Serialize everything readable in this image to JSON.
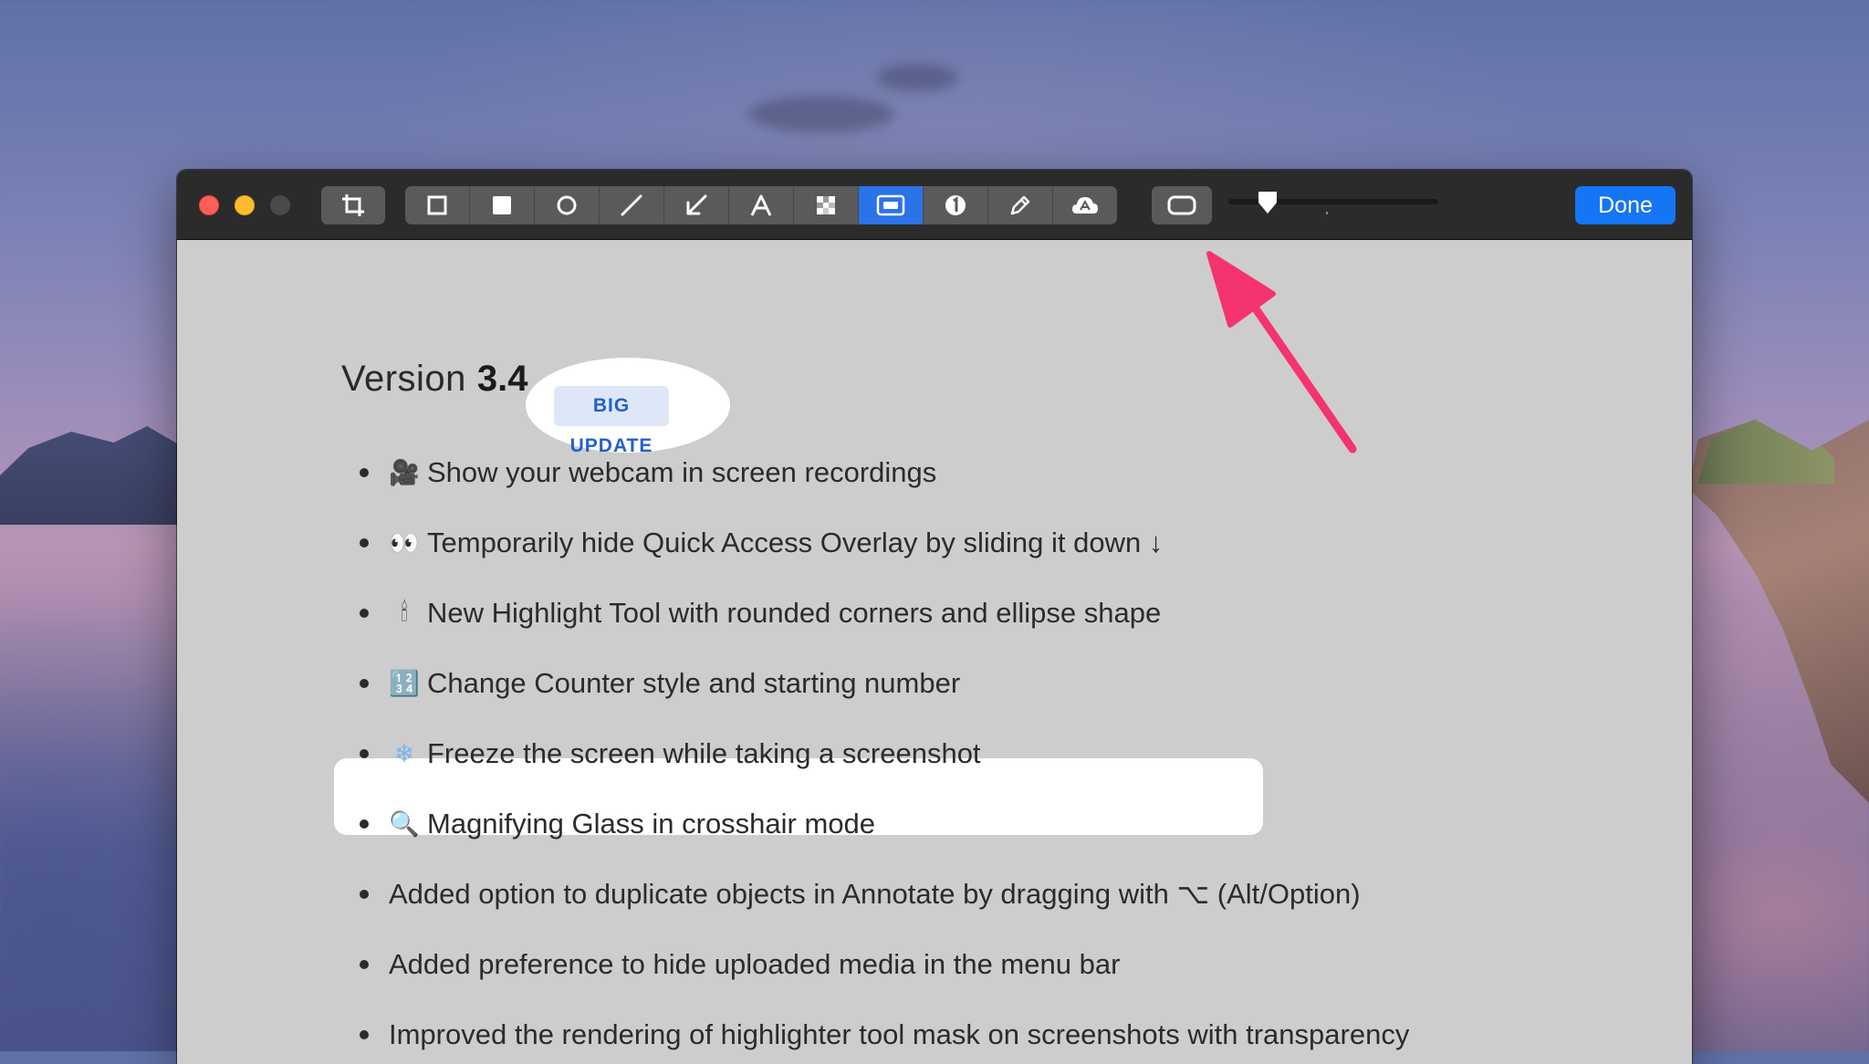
{
  "toolbar": {
    "tools": [
      {
        "name": "rectangle-outline-tool",
        "active": false
      },
      {
        "name": "rectangle-filled-tool",
        "active": false
      },
      {
        "name": "ellipse-tool",
        "active": false
      },
      {
        "name": "line-tool",
        "active": false
      },
      {
        "name": "arrow-tool",
        "active": false
      },
      {
        "name": "text-tool",
        "active": false
      },
      {
        "name": "pixelate-tool",
        "active": false
      },
      {
        "name": "highlight-tool",
        "active": true
      },
      {
        "name": "counter-tool",
        "active": false
      },
      {
        "name": "pencil-tool",
        "active": false
      },
      {
        "name": "cloud-tool",
        "active": false
      }
    ],
    "done_label": "Done",
    "accent_color": "#1475f5",
    "active_tool_color": "#2c72e8"
  },
  "content": {
    "version_label": "Version",
    "version_number": "3.4",
    "badge": "BIG UPDATE",
    "features": [
      {
        "emoji": "🎥",
        "text": "Show your webcam in screen recordings"
      },
      {
        "emoji": "👀",
        "text": "Temporarily hide Quick Access Overlay by sliding it down ↓"
      },
      {
        "emoji": "🕯",
        "text": "New Highlight Tool with rounded corners and ellipse shape"
      },
      {
        "emoji": "🔢",
        "text": "Change Counter style and starting number"
      },
      {
        "emoji": "❄",
        "text": "Freeze the screen while taking a screenshot"
      },
      {
        "emoji": "🔍",
        "text": "Magnifying Glass in crosshair mode"
      },
      {
        "emoji": "",
        "text": "Added option to duplicate objects in Annotate by dragging with ⌥ (Alt/Option)"
      },
      {
        "emoji": "",
        "text": "Added preference to hide uploaded media in the menu bar"
      },
      {
        "emoji": "",
        "text": "Improved the rendering of highlighter tool mask on screenshots with transparency"
      }
    ]
  },
  "annotation": {
    "arrow_color": "#f5336f"
  }
}
